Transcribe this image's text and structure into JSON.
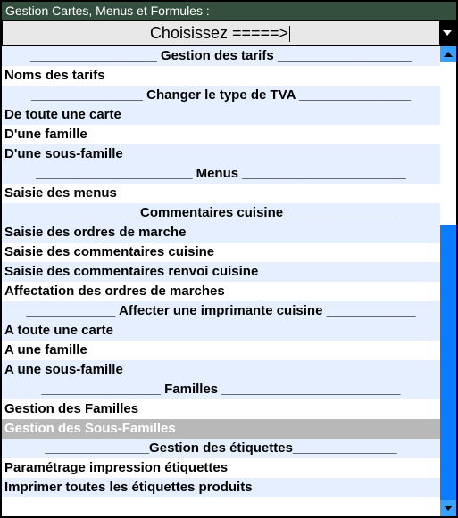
{
  "window": {
    "title": "Gestion Cartes, Menus et Formules  :"
  },
  "combo": {
    "prompt": "Choisissez  =====>"
  },
  "rows": [
    {
      "type": "header",
      "label": "_________________ Gestion des tarifs __________________"
    },
    {
      "type": "item",
      "label": "Noms des tarifs"
    },
    {
      "type": "header",
      "label": "_______________ Changer le type de TVA _______________"
    },
    {
      "type": "item",
      "label": "De toute une carte"
    },
    {
      "type": "item",
      "label": "D'une famille"
    },
    {
      "type": "item",
      "label": "D'une sous-famille"
    },
    {
      "type": "header",
      "label": "_____________________ Menus ______________________"
    },
    {
      "type": "item",
      "label": "Saisie des menus"
    },
    {
      "type": "header",
      "label": "_____________Commentaires cuisine _______________"
    },
    {
      "type": "item",
      "label": "Saisie des ordres de marche"
    },
    {
      "type": "item",
      "label": "Saisie des commentaires cuisine"
    },
    {
      "type": "item",
      "label": "Saisie des commentaires renvoi cuisine"
    },
    {
      "type": "item",
      "label": "Affectation des ordres de marches"
    },
    {
      "type": "header",
      "label": "____________ Affecter une imprimante cuisine ____________"
    },
    {
      "type": "item",
      "label": "A toute une carte"
    },
    {
      "type": "item",
      "label": "A une famille"
    },
    {
      "type": "item",
      "label": "A une sous-famille"
    },
    {
      "type": "header",
      "label": "________________ Familles ________________________"
    },
    {
      "type": "item",
      "label": "Gestion des Familles"
    },
    {
      "type": "item",
      "label": "Gestion des Sous-Familles",
      "selected": true
    },
    {
      "type": "header",
      "label": "______________Gestion des étiquettes______________"
    },
    {
      "type": "item",
      "label": "Paramétrage impression étiquettes"
    },
    {
      "type": "item",
      "label": "Imprimer toutes les étiquettes produits"
    }
  ],
  "scrollbar": {
    "thumb_top_pct": 37,
    "thumb_height_pct": 63
  }
}
